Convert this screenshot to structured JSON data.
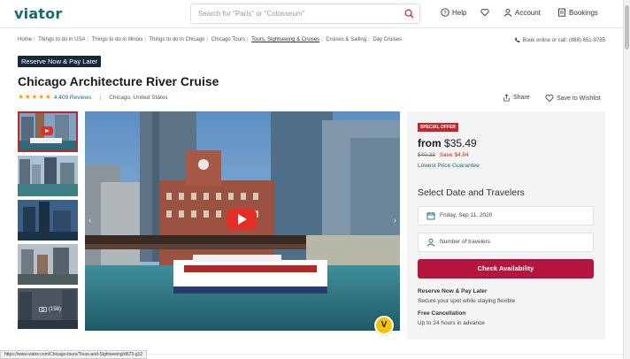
{
  "header": {
    "logo": "viator",
    "search_placeholder": "Search for \"Paris\" or \"Colosseum\"",
    "nav": {
      "help": "Help",
      "account": "Account",
      "bookings": "Bookings"
    }
  },
  "breadcrumb": [
    "Home",
    "Things to do in USA",
    "Things to do in Illinois",
    "Things to do in Chicago",
    "Chicago Tours",
    "Tours, Sightseeing & Cruises",
    "Cruises & Sailing",
    "Day Cruises"
  ],
  "phone_text": "Book online or call: (888) 651-9785",
  "badge": "Reserve Now & Pay Later",
  "title": "Chicago Architecture River Cruise",
  "rating": {
    "stars": 5,
    "reviews": "4,409 Reviews",
    "separator": "|",
    "location": "Chicago, United States"
  },
  "actions": {
    "share": "Share",
    "wishlist": "Save to Wishlist"
  },
  "gallery": {
    "photo_count": "(158)"
  },
  "panel": {
    "special": "SPECIAL OFFER",
    "from_label": "from",
    "price": "$35.49",
    "old_price": "$40.33",
    "save": "Save $4.84",
    "lowest": "Lowest Price Guarantee",
    "select_title": "Select Date and Travelers",
    "date_value": "Friday, Sep 11, 2020",
    "travelers_placeholder": "Number of travelers",
    "check_button": "Check Availability",
    "reserve_h": "Reserve Now & Pay Later",
    "reserve_t": "Secure your spot while staying flexible",
    "cancel_h": "Free Cancellation",
    "cancel_t": "Up to 24 hours in advance"
  },
  "status_url": "https://www.viator.com/Chicago-tours/Tours-and-Sightseeing/d673-g12",
  "colors": {
    "brand": "#186b6d",
    "accent": "#b3153f",
    "special": "#c1272d",
    "badge_bg": "#17283d",
    "star": "#f2a10c"
  }
}
